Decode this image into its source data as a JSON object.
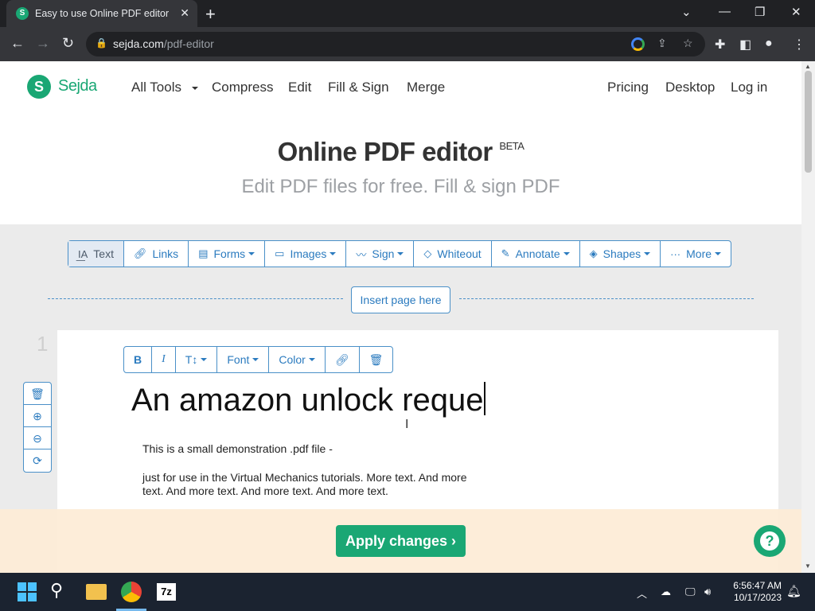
{
  "browser": {
    "tab_title": "Easy to use Online PDF editor",
    "tab_favicon_letter": "S",
    "url_domain": "sejda.com",
    "url_path": "/pdf-editor"
  },
  "site": {
    "logo_letter": "S",
    "logo_text": "Sejda",
    "nav": [
      "All Tools",
      "Compress",
      "Edit",
      "Fill & Sign",
      "Merge"
    ],
    "nav_right": [
      "Pricing",
      "Desktop",
      "Log in"
    ]
  },
  "hero": {
    "title": "Online PDF editor",
    "badge": "BETA",
    "subtitle": "Edit PDF files for free. Fill & sign PDF"
  },
  "toolbar": {
    "items": [
      {
        "label": "Text",
        "icon": "text-cursor-icon",
        "dropdown": false,
        "active": true
      },
      {
        "label": "Links",
        "icon": "link-icon",
        "dropdown": false
      },
      {
        "label": "Forms",
        "icon": "form-icon",
        "dropdown": true
      },
      {
        "label": "Images",
        "icon": "image-icon",
        "dropdown": true
      },
      {
        "label": "Sign",
        "icon": "signature-icon",
        "dropdown": true
      },
      {
        "label": "Whiteout",
        "icon": "eraser-icon",
        "dropdown": false
      },
      {
        "label": "Annotate",
        "icon": "pencil-icon",
        "dropdown": true
      },
      {
        "label": "Shapes",
        "icon": "shapes-icon",
        "dropdown": true
      },
      {
        "label": "More",
        "icon": "ellipsis-icon",
        "dropdown": true
      }
    ]
  },
  "insert_page_label": "Insert page here",
  "page_number": "1",
  "text_toolbar": {
    "bold": "B",
    "italic": "I",
    "size": "T↕",
    "font": "Font",
    "color": "Color"
  },
  "pdf": {
    "heading": "An amazon unlock reque",
    "line1": "This is a small demonstration .pdf file -",
    "line2": "just for use in the Virtual Mechanics tutorials. More text. And more",
    "line3": "text. And more text. And more text. And more text."
  },
  "apply_button": "Apply changes",
  "help_label": "?",
  "taskbar": {
    "time": "6:56:47 AM",
    "date": "10/17/2023"
  },
  "colors": {
    "brand": "#1aa774",
    "accent": "#2b7bbf"
  }
}
